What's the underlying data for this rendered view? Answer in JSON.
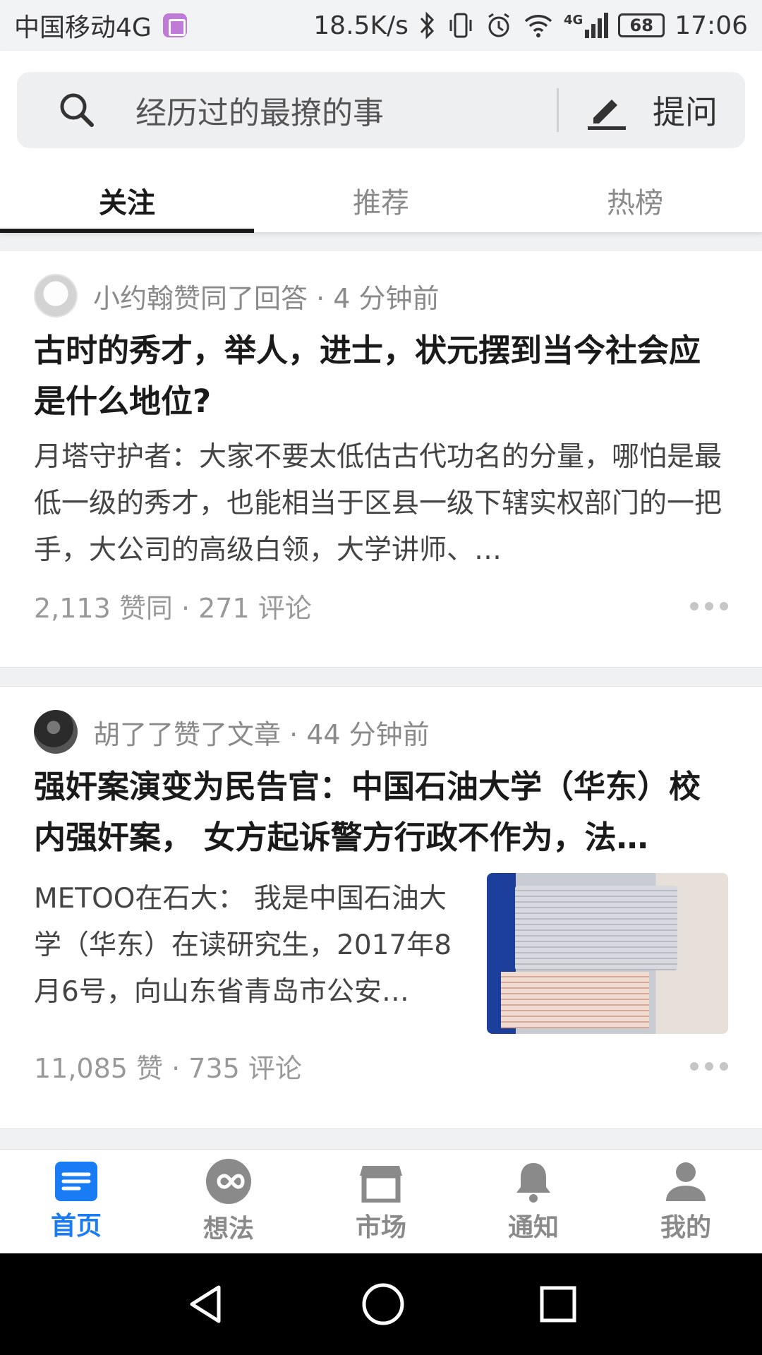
{
  "status_bar": {
    "carrier": "中国移动4G",
    "speed": "18.5K/s",
    "network": "4G",
    "battery": "68",
    "time": "17:06"
  },
  "search": {
    "placeholder": "经历过的最撩的事",
    "ask_label": "提问"
  },
  "tabs": [
    {
      "label": "关注",
      "active": true
    },
    {
      "label": "推荐",
      "active": false
    },
    {
      "label": "热榜",
      "active": false
    }
  ],
  "feed": [
    {
      "actor_line": "小约翰赞同了回答 · 4 分钟前",
      "title": "古时的秀才，举人，进士，状元摆到当今社会应是什么地位?",
      "excerpt": "月塔守护者：大家不要太低估古代功名的分量，哪怕是最低一级的秀才，也能相当于区县一级下辖实权部门的一把手，大公司的高级白领，大学讲师、…",
      "stats": "2,113 赞同 · 271 评论"
    },
    {
      "actor_line": "胡了了赞了文章 · 44 分钟前",
      "title": "强奸案演变为民告官：中国石油大学（华东）校内强奸案， 女方起诉警方行政不作为，法…",
      "excerpt": "METOO在石大： 我是中国石油大学（华东）在读研究生，2017年8月6号，向山东省青岛市公安…",
      "stats": "11,085 赞 · 735 评论"
    }
  ],
  "bottom_nav": [
    {
      "label": "首页",
      "icon": "home-doc-icon",
      "active": true
    },
    {
      "label": "想法",
      "icon": "idea-infinity-icon",
      "active": false
    },
    {
      "label": "市场",
      "icon": "store-icon",
      "active": false
    },
    {
      "label": "通知",
      "icon": "bell-icon",
      "active": false
    },
    {
      "label": "我的",
      "icon": "person-icon",
      "active": false
    }
  ],
  "colors": {
    "accent": "#1a7cf5",
    "text_primary": "#1a1a1a",
    "text_secondary": "#8a8a8a"
  }
}
